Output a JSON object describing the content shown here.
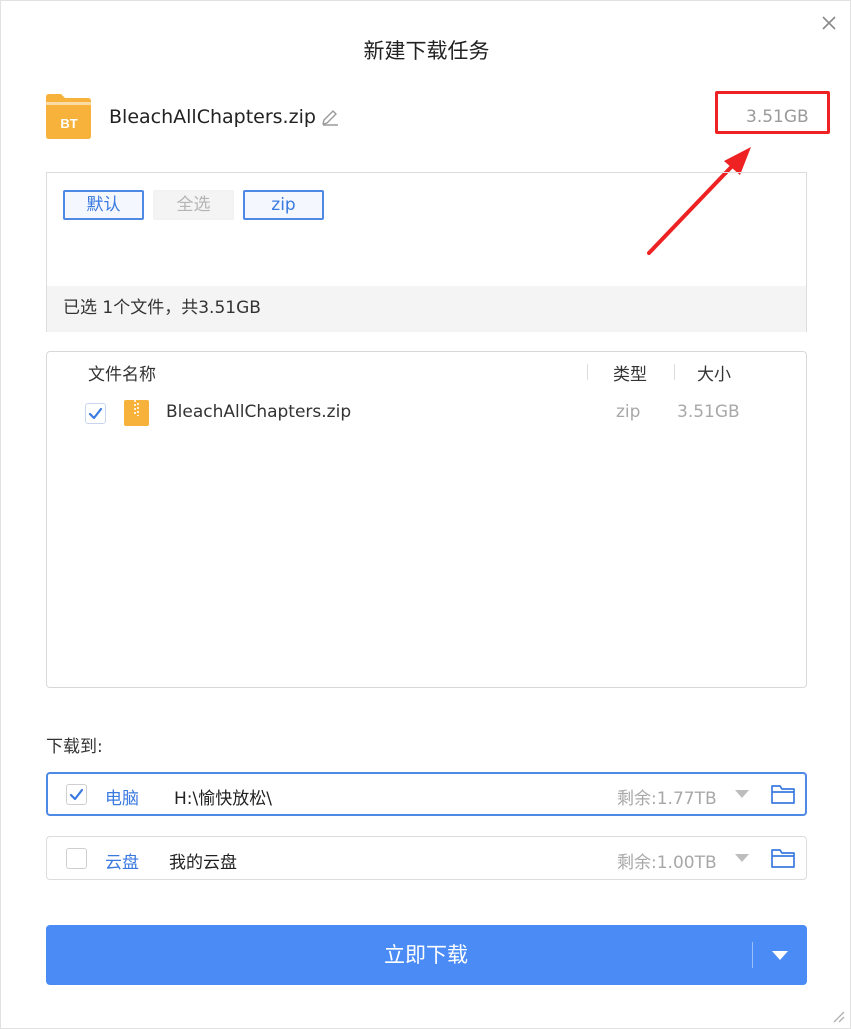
{
  "dialog": {
    "title": "新建下载任务"
  },
  "file": {
    "name": "BleachAllChapters.zip",
    "icon_label": "BT",
    "total_size": "3.51GB"
  },
  "filters": {
    "default_label": "默认",
    "select_all_label": "全选",
    "zip_label": "zip",
    "summary": "已选 1个文件，共3.51GB"
  },
  "file_list": {
    "columns": {
      "name": "文件名称",
      "type": "类型",
      "size": "大小"
    },
    "rows": [
      {
        "name": "BleachAllChapters.zip",
        "type": "zip",
        "size": "3.51GB",
        "checked": true
      }
    ]
  },
  "destination": {
    "label": "下载到:",
    "options": [
      {
        "name": "电脑",
        "path": "H:\\愉快放松\\",
        "free": "剩余:1.77TB",
        "checked": true
      },
      {
        "name": "云盘",
        "path": "我的云盘",
        "free": "剩余:1.00TB",
        "checked": false
      }
    ]
  },
  "actions": {
    "download_label": "立即下载"
  },
  "colors": {
    "accent": "#4a8bf5",
    "highlight": "#ee2222",
    "folder": "#f7b23b"
  },
  "icons": [
    "close-icon",
    "bt-file-icon",
    "edit-icon",
    "zip-file-icon",
    "check-icon",
    "chevron-down-icon",
    "folder-icon",
    "resize-grip-icon"
  ]
}
